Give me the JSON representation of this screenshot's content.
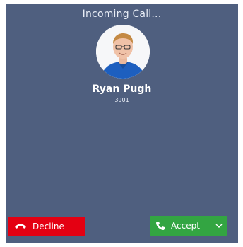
{
  "header": {
    "title": "Incoming Call..."
  },
  "caller": {
    "name": "Ryan Pugh",
    "extension": "3901"
  },
  "actions": {
    "decline_label": "Decline",
    "accept_label": "Accept"
  },
  "icons": {
    "decline": "phone-hangup-icon",
    "accept": "phone-icon",
    "menu": "chevron-down-icon"
  },
  "colors": {
    "background": "#4f5f7f",
    "decline": "#e40012",
    "accept": "#33a542"
  }
}
